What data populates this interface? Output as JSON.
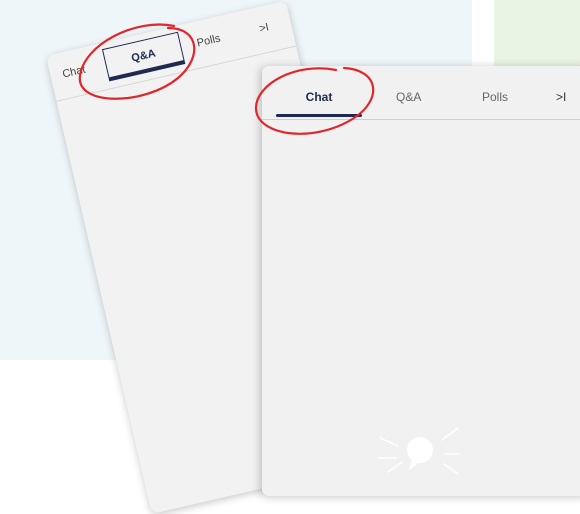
{
  "back_panel": {
    "tabs": [
      "Chat",
      "Q&A",
      "Polls"
    ],
    "collapse_label": ">I",
    "active_tab": "Q&A"
  },
  "front_panel": {
    "tabs": [
      "Chat",
      "Q&A",
      "Polls"
    ],
    "collapse_label": ">I",
    "active_tab": "Chat"
  },
  "icons": {
    "empty_state": "chat-bubble-icon",
    "collapse": "collapse-right-icon"
  },
  "colors": {
    "accent_navy": "#1e2a52",
    "annotation_red": "#e0262a",
    "panel_bg": "#f2f2f2",
    "page_bg_blue": "#eef6fa",
    "page_bg_green": "#e9f4e4"
  }
}
